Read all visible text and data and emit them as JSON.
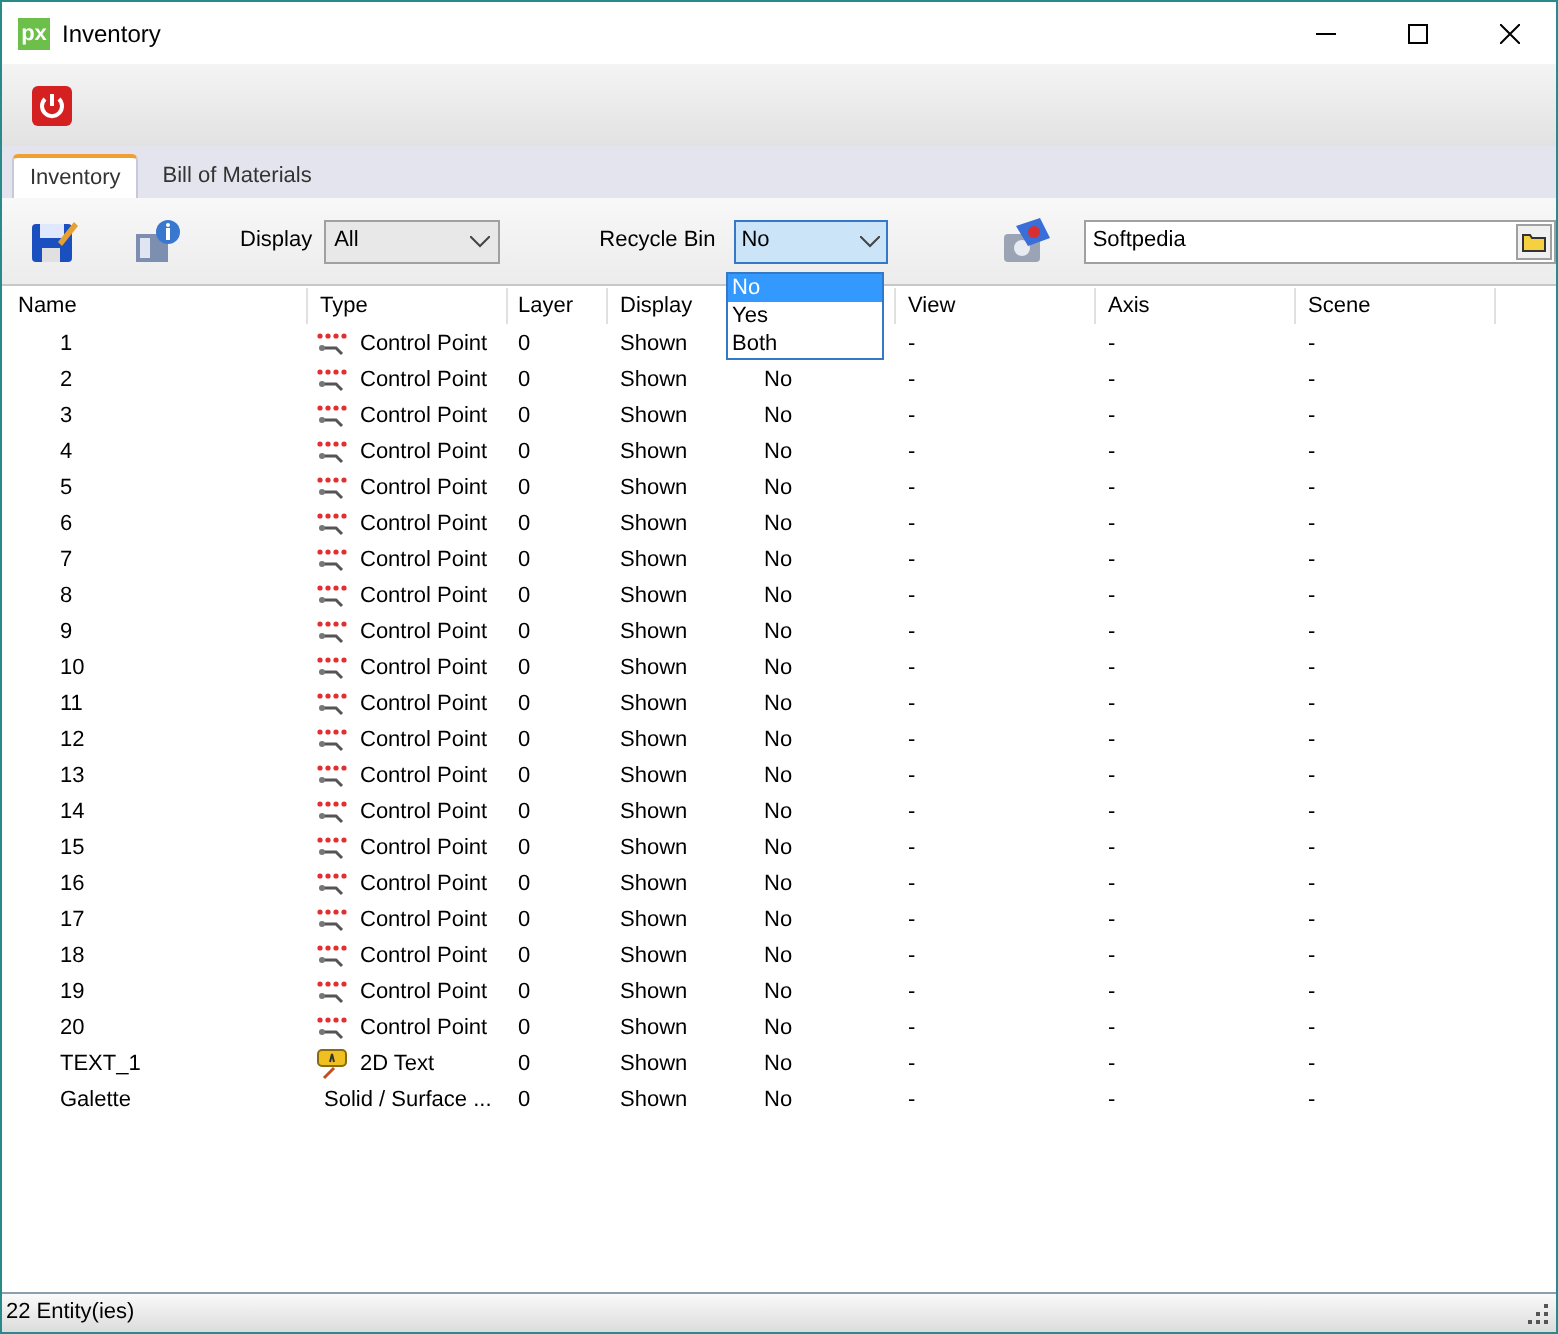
{
  "window": {
    "title": "Inventory",
    "logo": "px"
  },
  "tabs": [
    {
      "label": "Inventory",
      "selected": true
    },
    {
      "label": "Bill of Materials",
      "selected": false
    }
  ],
  "toolbar": {
    "display_label": "Display",
    "display_value": "All",
    "recycle_label": "Recycle Bin",
    "recycle_value": "No",
    "search_value": "Softpedia"
  },
  "dropdown": {
    "options": [
      {
        "label": "No",
        "selected": true
      },
      {
        "label": "Yes",
        "selected": false
      },
      {
        "label": "Both",
        "selected": false
      }
    ]
  },
  "table": {
    "columns": [
      "Name",
      "Type",
      "Layer",
      "Display",
      "View",
      "Axis",
      "Scene"
    ],
    "rows": [
      {
        "name": "1",
        "kind": "control_point",
        "type": "Control Point",
        "layer": "0",
        "display": "Shown",
        "view": "-",
        "axis": "-",
        "scene": "-"
      },
      {
        "name": "2",
        "kind": "control_point",
        "type": "Control Point",
        "layer": "0",
        "display": "Shown",
        "column_5": "No",
        "view": "-",
        "axis": "-",
        "scene": "-"
      },
      {
        "name": "3",
        "kind": "control_point",
        "type": "Control Point",
        "layer": "0",
        "display": "Shown",
        "column_5": "No",
        "view": "-",
        "axis": "-",
        "scene": "-"
      },
      {
        "name": "4",
        "kind": "control_point",
        "type": "Control Point",
        "layer": "0",
        "display": "Shown",
        "column_5": "No",
        "view": "-",
        "axis": "-",
        "scene": "-"
      },
      {
        "name": "5",
        "kind": "control_point",
        "type": "Control Point",
        "layer": "0",
        "display": "Shown",
        "column_5": "No",
        "view": "-",
        "axis": "-",
        "scene": "-"
      },
      {
        "name": "6",
        "kind": "control_point",
        "type": "Control Point",
        "layer": "0",
        "display": "Shown",
        "column_5": "No",
        "view": "-",
        "axis": "-",
        "scene": "-"
      },
      {
        "name": "7",
        "kind": "control_point",
        "type": "Control Point",
        "layer": "0",
        "display": "Shown",
        "column_5": "No",
        "view": "-",
        "axis": "-",
        "scene": "-"
      },
      {
        "name": "8",
        "kind": "control_point",
        "type": "Control Point",
        "layer": "0",
        "display": "Shown",
        "column_5": "No",
        "view": "-",
        "axis": "-",
        "scene": "-"
      },
      {
        "name": "9",
        "kind": "control_point",
        "type": "Control Point",
        "layer": "0",
        "display": "Shown",
        "column_5": "No",
        "view": "-",
        "axis": "-",
        "scene": "-"
      },
      {
        "name": "10",
        "kind": "control_point",
        "type": "Control Point",
        "layer": "0",
        "display": "Shown",
        "column_5": "No",
        "view": "-",
        "axis": "-",
        "scene": "-"
      },
      {
        "name": "11",
        "kind": "control_point",
        "type": "Control Point",
        "layer": "0",
        "display": "Shown",
        "column_5": "No",
        "view": "-",
        "axis": "-",
        "scene": "-"
      },
      {
        "name": "12",
        "kind": "control_point",
        "type": "Control Point",
        "layer": "0",
        "display": "Shown",
        "column_5": "No",
        "view": "-",
        "axis": "-",
        "scene": "-"
      },
      {
        "name": "13",
        "kind": "control_point",
        "type": "Control Point",
        "layer": "0",
        "display": "Shown",
        "column_5": "No",
        "view": "-",
        "axis": "-",
        "scene": "-"
      },
      {
        "name": "14",
        "kind": "control_point",
        "type": "Control Point",
        "layer": "0",
        "display": "Shown",
        "column_5": "No",
        "view": "-",
        "axis": "-",
        "scene": "-"
      },
      {
        "name": "15",
        "kind": "control_point",
        "type": "Control Point",
        "layer": "0",
        "display": "Shown",
        "column_5": "No",
        "view": "-",
        "axis": "-",
        "scene": "-"
      },
      {
        "name": "16",
        "kind": "control_point",
        "type": "Control Point",
        "layer": "0",
        "display": "Shown",
        "column_5": "No",
        "view": "-",
        "axis": "-",
        "scene": "-"
      },
      {
        "name": "17",
        "kind": "control_point",
        "type": "Control Point",
        "layer": "0",
        "display": "Shown",
        "column_5": "No",
        "view": "-",
        "axis": "-",
        "scene": "-"
      },
      {
        "name": "18",
        "kind": "control_point",
        "type": "Control Point",
        "layer": "0",
        "display": "Shown",
        "column_5": "No",
        "view": "-",
        "axis": "-",
        "scene": "-"
      },
      {
        "name": "19",
        "kind": "control_point",
        "type": "Control Point",
        "layer": "0",
        "display": "Shown",
        "column_5": "No",
        "view": "-",
        "axis": "-",
        "scene": "-"
      },
      {
        "name": "20",
        "kind": "control_point",
        "type": "Control Point",
        "layer": "0",
        "display": "Shown",
        "column_5": "No",
        "view": "-",
        "axis": "-",
        "scene": "-"
      },
      {
        "name": "TEXT_1",
        "kind": "text",
        "type": "2D Text",
        "layer": "0",
        "display": "Shown",
        "column_5": "No",
        "view": "-",
        "axis": "-",
        "scene": "-"
      },
      {
        "name": "Galette",
        "kind": "solid",
        "type": "Solid / Surface ...",
        "layer": "0",
        "display": "Shown",
        "column_5": "No",
        "view": "-",
        "axis": "-",
        "scene": "-"
      }
    ]
  },
  "status_bar": "22 Entity(ies)"
}
